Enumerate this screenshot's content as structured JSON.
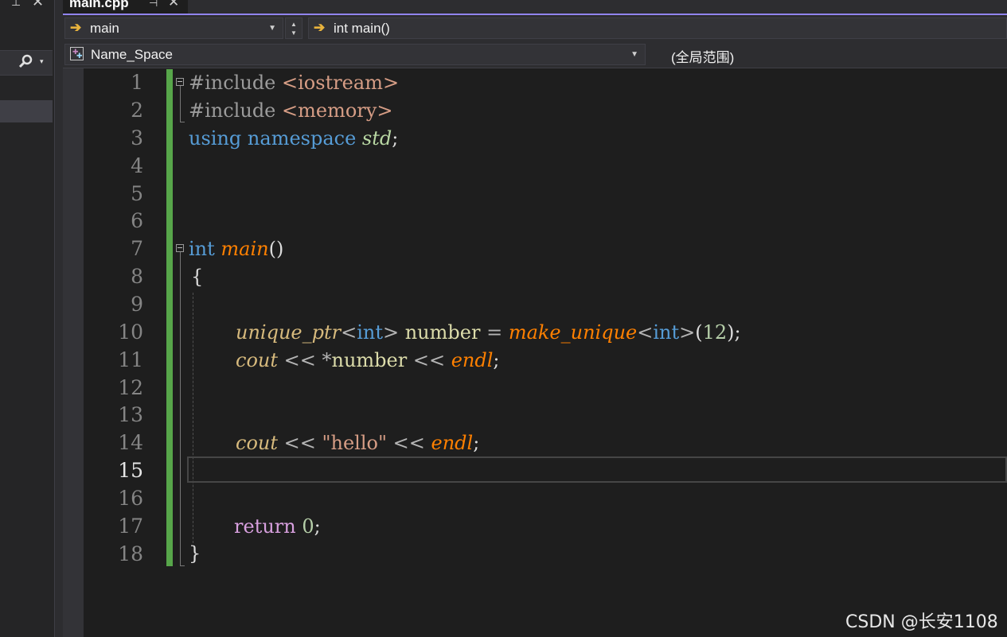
{
  "left_pane": {
    "pin_glyph": "⊥",
    "close_glyph": "✕",
    "search_icon": "search-icon",
    "search_dropdown_glyph": "▾"
  },
  "tab": {
    "title": "main.cpp",
    "pin_glyph": "⊣",
    "close_glyph": "✕"
  },
  "nav": {
    "function_combo": "main",
    "member_combo": "int main()",
    "namespace_combo": "Name_Space",
    "scope": "(全局范围)",
    "arrow_glyph": "➔",
    "dropdown_glyph": "▼",
    "spin_up": "▲",
    "spin_down": "▼"
  },
  "editor": {
    "line_numbers": [
      "1",
      "2",
      "3",
      "4",
      "5",
      "6",
      "7",
      "8",
      "9",
      "10",
      "11",
      "12",
      "13",
      "14",
      "15",
      "16",
      "17",
      "18"
    ],
    "current_line": "15",
    "code": {
      "l1_pp": "#include ",
      "l1_str": "<iostream>",
      "l2_pp": "#include ",
      "l2_str": "<memory>",
      "l3_kw1": "using",
      "l3_kw2": "namespace",
      "l3_std": "std",
      "l3_semi": ";",
      "l7_kw": "int",
      "l7_fn": "main",
      "l7_paren": "()",
      "l8_brace": "{",
      "l10_cls": "unique_ptr",
      "l10_lt": "<",
      "l10_int": "int",
      "l10_gt": ">",
      "l10_var": " number ",
      "l10_eq": "= ",
      "l10_fn": "make_unique",
      "l10_lt2": "<",
      "l10_int2": "int",
      "l10_gt2": ">",
      "l10_open": "(",
      "l10_num": "12",
      "l10_close": ");",
      "l11_cout": "cout",
      "l11_op1": " << *",
      "l11_var": "number",
      "l11_op2": " << ",
      "l11_endl": "endl",
      "l11_semi": ";",
      "l14_cout": "cout",
      "l14_op1": " << ",
      "l14_str": "\"hello\"",
      "l14_op2": " << ",
      "l14_endl": "endl",
      "l14_semi": ";",
      "l17_ret": "return",
      "l17_num": " 0",
      "l17_semi": ";",
      "l18_brace": "}"
    }
  },
  "watermark": "CSDN @长安1108",
  "colors": {
    "background": "#1e1e1e",
    "change_bar": "#57a64a",
    "tab_accent": "#9184ee",
    "keyword": "#569cd6",
    "function": "#ff8000",
    "string": "#d69d85",
    "number": "#b5cea8",
    "return_kw": "#d8a0df"
  }
}
